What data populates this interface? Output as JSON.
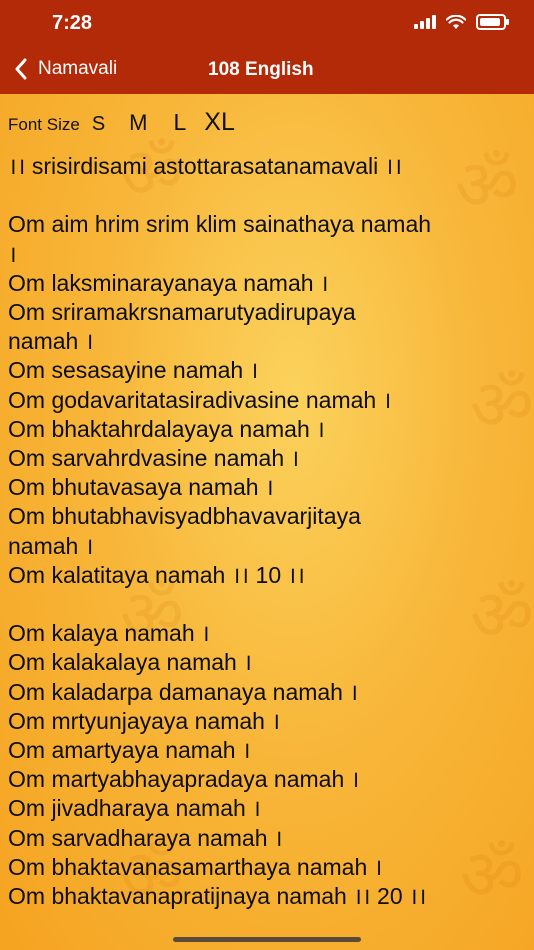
{
  "status": {
    "time": "7:28"
  },
  "nav": {
    "back_label": "Namavali",
    "title": "108 English"
  },
  "font_size": {
    "label": "Font Size",
    "options": [
      "S",
      "M",
      "L",
      "XL"
    ]
  },
  "lines": [
    "।। srisirdisami astottarasatanamavali ।।",
    "",
    "Om aim hrim srim klim sainathaya namah",
    "।",
    "Om laksminarayanaya namah ।",
    "Om sriramakrsnamarutyadirupaya",
    "namah ।",
    "Om sesasayine namah ।",
    "Om godavaritatasiradivasine namah ।",
    "Om bhaktahrdalayaya namah ।",
    "Om sarvahrdvasine namah ।",
    "Om bhutavasaya namah ।",
    "Om bhutabhavisyadbhavavarjitaya",
    "namah ।",
    "Om kalatitaya namah ।। 10 ।।",
    "",
    "Om kalaya namah ।",
    "Om kalakalaya namah ।",
    "Om kaladarpa damanaya namah ।",
    "Om mrtyunjayaya namah ।",
    "Om amartyaya namah ।",
    "Om martyabhayapradaya namah ।",
    "Om jivadharaya namah ।",
    "Om sarvadharaya namah ।",
    "Om bhaktavanasamarthaya namah ।",
    "Om bhaktavanapratijnaya namah ।। 20 ।।"
  ],
  "colors": {
    "header": "#b22a08",
    "background": "#f7a825"
  }
}
